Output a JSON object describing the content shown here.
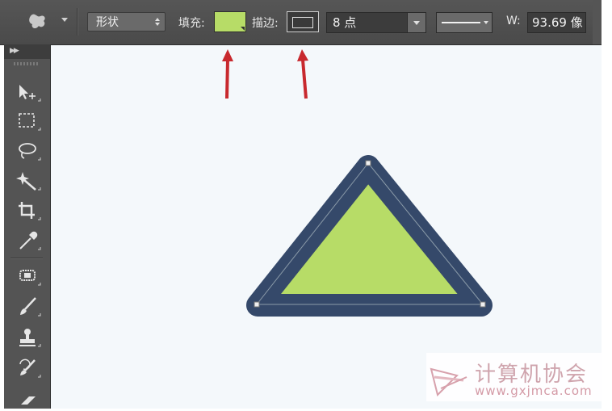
{
  "options_bar": {
    "tool_icon": "custom-shape-tool-icon",
    "mode_value": "形状",
    "fill_label": "填充:",
    "fill_color": "#b7dc67",
    "stroke_label": "描边:",
    "stroke_width": "8 点",
    "width_label": "W:",
    "width_value": "93.69 像"
  },
  "annotations": {
    "arrow_color": "#c8292e"
  },
  "toolbar": {
    "tools": [
      "move-tool-icon",
      "marquee-tool-icon",
      "lasso-tool-icon",
      "magic-wand-tool-icon",
      "crop-tool-icon",
      "eyedropper-tool-icon",
      "healing-brush-tool-icon",
      "brush-tool-icon",
      "clone-stamp-tool-icon",
      "history-brush-tool-icon",
      "eraser-tool-icon"
    ]
  },
  "canvas": {
    "shape": "triangle",
    "shape_fill": "#b7dc67",
    "shape_stroke": "#35496a",
    "background": "#f4f8fb"
  },
  "watermark": {
    "text": "计算机协会",
    "url": "www.gxjmca.com"
  }
}
